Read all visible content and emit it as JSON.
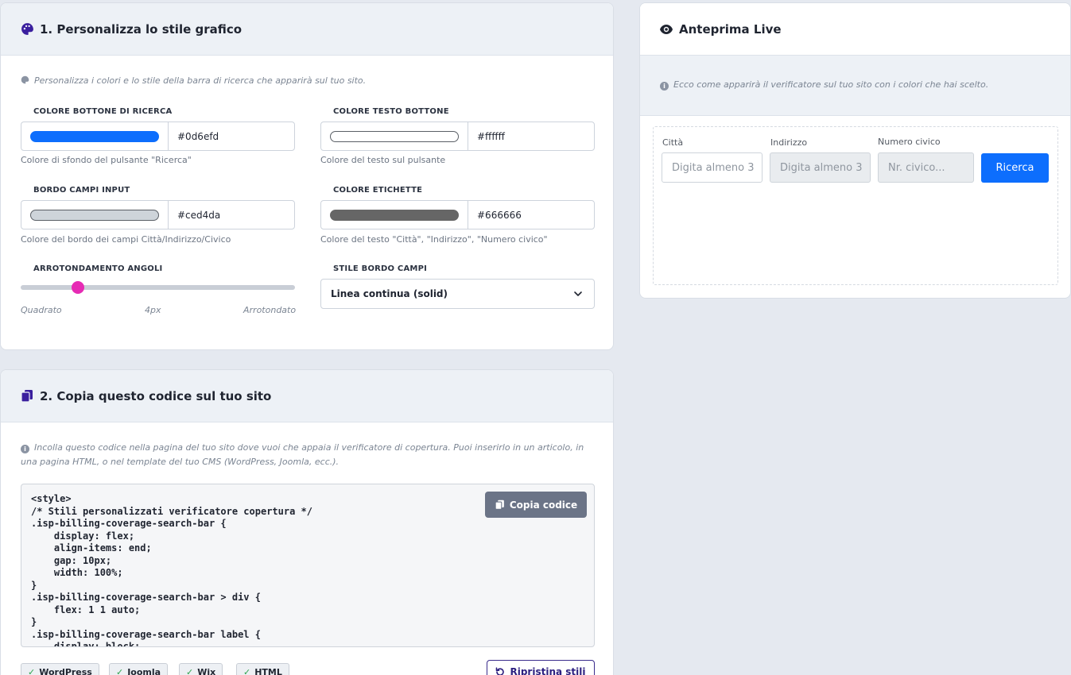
{
  "style_card": {
    "title": "1. Personalizza lo stile grafico",
    "note": "Personalizza i colori e lo stile della barra di ricerca che apparirà sul tuo sito.",
    "button_color": {
      "label": "COLORE BOTTONE DI RICERCA",
      "value": "#0d6efd",
      "hint": "Colore di sfondo del pulsante \"Ricerca\""
    },
    "button_text_color": {
      "label": "COLORE TESTO BOTTONE",
      "value": "#ffffff",
      "hint": "Colore del testo sul pulsante"
    },
    "input_border": {
      "label": "BORDO CAMPI INPUT",
      "value": "#ced4da",
      "hint": "Colore del bordo dei campi Città/Indirizzo/Civico"
    },
    "label_color": {
      "label": "COLORE ETICHETTE",
      "value": "#666666",
      "hint": "Colore del testo \"Città\", \"Indirizzo\", \"Numero civico\""
    },
    "radius": {
      "label": "ARROTONDAMENTO ANGOLI",
      "min_label": "Quadrato",
      "value_label": "4px",
      "max_label": "Arrotondato",
      "fraction": 0.21,
      "thumb_color": "#e62bb4"
    },
    "border_style": {
      "label": "STILE BORDO CAMPI",
      "selected": "Linea continua (solid)"
    }
  },
  "code_card": {
    "title": "2. Copia questo codice sul tuo sito",
    "note": "Incolla questo codice nella pagina del tuo sito dove vuoi che appaia il verificatore di copertura. Puoi inserirlo in un articolo, in una pagina HTML, o nel template del tuo CMS (WordPress, Joomla, ecc.).",
    "code": "<style>\n/* Stili personalizzati verificatore copertura */\n.isp-billing-coverage-search-bar {\n    display: flex;\n    align-items: end;\n    gap: 10px;\n    width: 100%;\n}\n.isp-billing-coverage-search-bar > div {\n    flex: 1 1 auto;\n}\n.isp-billing-coverage-search-bar label {\n    display: block;",
    "copy_label": "Copia codice",
    "tags": [
      "WordPress",
      "Joomla",
      "Wix",
      "HTML"
    ],
    "reset_label": "Ripristina stili"
  },
  "preview_card": {
    "title": "Anteprima Live",
    "note": "Ecco come apparirà il verificatore sul tuo sito con i colori che hai scelto.",
    "city_label": "Città",
    "city_placeholder": "Digita almeno 3",
    "address_label": "Indirizzo",
    "address_placeholder": "Digita almeno 3",
    "civic_label": "Numero civico",
    "civic_placeholder": "Nr. civico...",
    "search_label": "Ricerca"
  },
  "colors": {
    "accent": "#0d6efd",
    "header_icon": "#3a1f9e",
    "page_bg": "#e5e9f0"
  }
}
